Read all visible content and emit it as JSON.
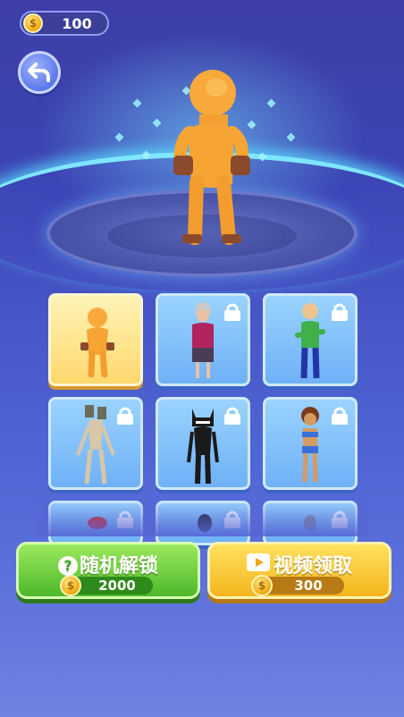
{
  "hud": {
    "coins": "100",
    "coin_symbol": "$"
  },
  "buttons": {
    "random": {
      "label": "随机解锁",
      "price": "2000",
      "icon": "question-icon"
    },
    "video": {
      "label": "视频领取",
      "price": "300",
      "icon": "video-play-icon"
    }
  },
  "skins": [
    {
      "name": "orange-dummy",
      "selected": true,
      "locked": false
    },
    {
      "name": "old-lady",
      "selected": false,
      "locked": true
    },
    {
      "name": "baldi-teacher",
      "selected": false,
      "locked": true
    },
    {
      "name": "siren-head",
      "selected": false,
      "locked": true
    },
    {
      "name": "cartoon-cat",
      "selected": false,
      "locked": true
    },
    {
      "name": "tribal-girl",
      "selected": false,
      "locked": true
    },
    {
      "name": "red-cap",
      "selected": false,
      "locked": true
    },
    {
      "name": "dark-figure",
      "selected": false,
      "locked": true
    },
    {
      "name": "grey-figure",
      "selected": false,
      "locked": true
    }
  ],
  "colors": {
    "accent_green": "#4db82a",
    "accent_gold": "#f5b51d",
    "selected_card": "#ffd86e"
  }
}
